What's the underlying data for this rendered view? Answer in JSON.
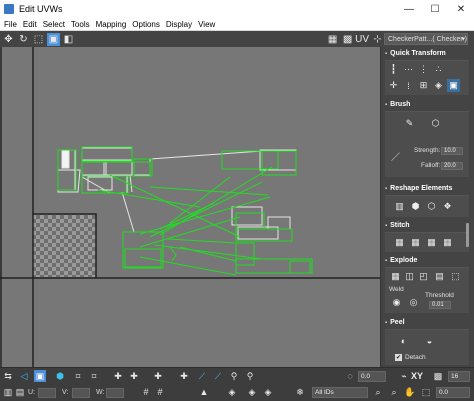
{
  "window": {
    "title": "Edit UVWs",
    "min_glyph": "—",
    "max_glyph": "☐",
    "close_glyph": "✕"
  },
  "menu": {
    "items": [
      "File",
      "Edit",
      "Select",
      "Tools",
      "Mapping",
      "Options",
      "Display",
      "View"
    ]
  },
  "toolbar": {
    "icons": [
      "move-icon",
      "rotate-icon",
      "scale-icon",
      "freeform-icon",
      "mirror-icon"
    ],
    "uv_label": "UV",
    "checker_dropdown": "CheckerPatt...( Checker )",
    "checker_arrow": "▾"
  },
  "panel": {
    "quick_transform": "Quick Transform",
    "brush": "Brush",
    "strength_label": "Strength:",
    "strength_value": "10.0",
    "falloff_label": "Falloff:",
    "falloff_value": "20.0",
    "reshape_elements": "Reshape Elements",
    "stitch": "Stitch",
    "explode": "Explode",
    "weld_label": "Weld",
    "threshold_label": "Threshold",
    "threshold_value": "0.01",
    "peel": "Peel",
    "detach_label": "Detach",
    "detach_checked": true,
    "rollout_marker": "▪"
  },
  "bottom": {
    "u_label": "U:",
    "v_label": "V:",
    "w_label": "W:",
    "u_value": "",
    "v_value": "",
    "w_value": "",
    "xy_label": "XY",
    "zoom_value": "0.0",
    "snap_value": "16",
    "filter_value": "All IDs",
    "spinner_value": "0.0"
  },
  "colors": {
    "accent_blue": "#4a8fd8",
    "uv_wire": "#22dd22",
    "checker_light": "#9a9a9a",
    "checker_dark": "#6e6e6e"
  }
}
